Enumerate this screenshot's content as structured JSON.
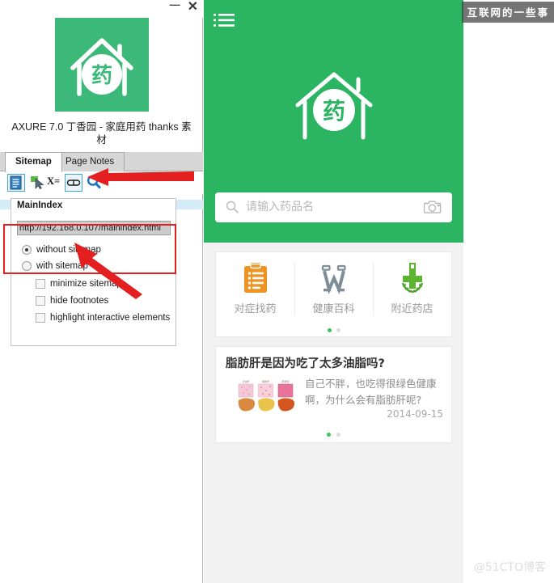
{
  "window": {
    "minimize_label": "—",
    "close_label": "✕",
    "app_title": "AXURE 7.0 丁香园 - 家庭用药 thanks 素材"
  },
  "tabs": [
    {
      "label": "Sitemap",
      "active": true
    },
    {
      "label": "Page Notes",
      "active": false
    }
  ],
  "toolbar": {
    "generate_icon": "page-generate-icon",
    "cursor_icon": "pointer-select-icon",
    "xeq_label": "X=",
    "link_icon": "link-chain-icon",
    "search_icon": "magnifier-icon"
  },
  "sitemap": {
    "node_label": "MainIndex",
    "url_value": "http://192.168.0.107/mainindex.html",
    "options": [
      {
        "label": "without sitemap",
        "type": "radio",
        "checked": true
      },
      {
        "label": "with sitemap",
        "type": "radio",
        "checked": false
      },
      {
        "label": "minimize sitemap",
        "type": "checkbox",
        "checked": false
      },
      {
        "label": "hide footnotes",
        "type": "checkbox",
        "checked": false
      },
      {
        "label": "highlight interactive elements",
        "type": "checkbox",
        "checked": false
      }
    ]
  },
  "annotation": {
    "highlight_color": "#e41f1f"
  },
  "preview": {
    "hero": {
      "bg_color": "#2bb462",
      "menu_icon": "list-menu-icon",
      "logo_icon": "house-medicine-logo"
    },
    "search": {
      "placeholder": "请输入药品名",
      "search_icon": "magnifier-icon",
      "camera_icon": "camera-icon"
    },
    "features": [
      {
        "label": "对症找药",
        "icon": "clipboard-icon",
        "color": "#ef9322"
      },
      {
        "label": "健康百科",
        "icon": "wiki-w-icon",
        "color": "#7c8d98"
      },
      {
        "label": "附近药店",
        "icon": "pharmacy-cross-laurel-icon",
        "color": "#5cb531"
      }
    ],
    "feature_pager": {
      "total": 2,
      "active": 1
    },
    "article": {
      "title": "脂肪肝是因为吃了太多油脂吗?",
      "summary": "自己不胖，也吃得很绿色健康啊，为什么会有脂肪肝呢?",
      "date": "2014-09-15",
      "thumb_icon": "liver-comparison-thumbnail"
    },
    "article_pager": {
      "total": 2,
      "active": 1
    }
  },
  "watermarks": {
    "top_right": "互联网的一些事",
    "bottom_right": "@51CTO博客"
  }
}
